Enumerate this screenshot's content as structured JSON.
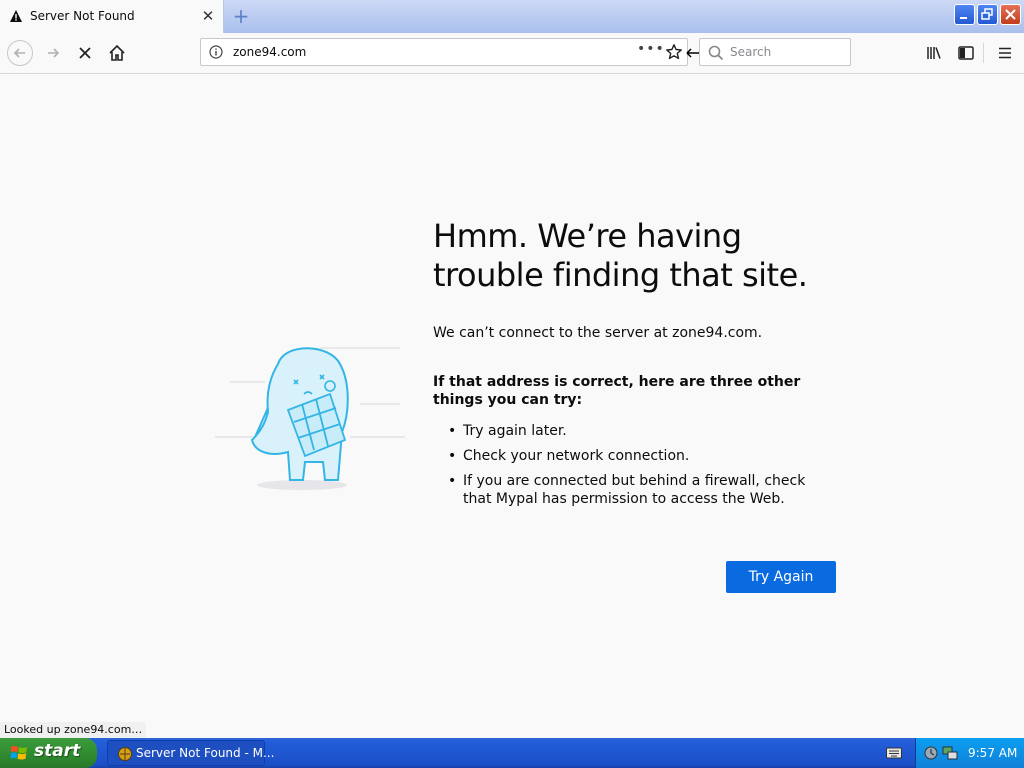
{
  "browser": {
    "tab_title": "Server Not Found",
    "url": "zone94.com",
    "search_placeholder": "Search"
  },
  "error": {
    "title": "Hmm. We’re having trouble finding that site.",
    "description": "We can’t connect to the server at zone94.com.",
    "hint": "If that address is correct, here are three other things you can try:",
    "suggestions": [
      "Try again later.",
      "Check your network connection.",
      "If you are connected but behind a firewall, check that Mypal has permission to access the Web."
    ],
    "button_label": "Try Again"
  },
  "status_text": "Looked up zone94.com…",
  "taskbar": {
    "start_label": "start",
    "task_label": "Server Not Found - M...",
    "clock": "9:57 AM"
  },
  "colors": {
    "accent_button": "#0a6ae0",
    "taskbar_blue": "#245edb",
    "start_green": "#3c9c3c"
  },
  "icons": [
    "warning-icon",
    "close-icon",
    "plus-icon",
    "back-icon",
    "forward-icon",
    "stop-icon",
    "home-icon",
    "info-icon",
    "more-icon",
    "star-icon",
    "search-icon",
    "library-icon",
    "sidebar-icon",
    "menu-icon",
    "windows-logo-icon",
    "keyboard-icon",
    "tray-icon",
    "tray-network-icon"
  ]
}
